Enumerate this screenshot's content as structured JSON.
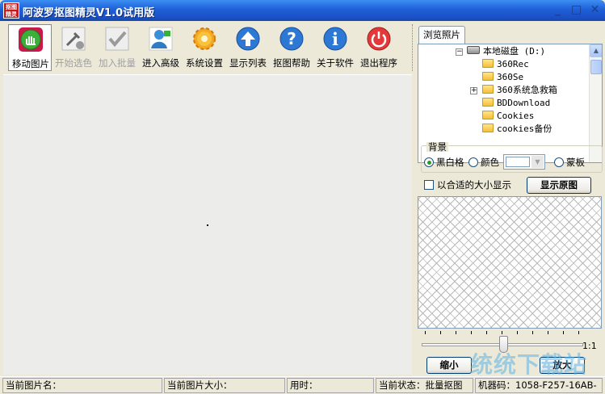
{
  "window": {
    "app_icon_text": "抠图\n精灵",
    "title": "阿波罗抠图精灵V1.0试用版",
    "controls": {
      "minimize": "_",
      "maximize": "□",
      "close": "✕"
    }
  },
  "toolbar": {
    "buttons": [
      {
        "label": "移动图片",
        "icon": "hand-icon",
        "enabled": true,
        "active": true
      },
      {
        "label": "开始选色",
        "icon": "eyedropper-icon",
        "enabled": false
      },
      {
        "label": "加入批量",
        "icon": "checkmark-icon",
        "enabled": false
      },
      {
        "label": "进入高级",
        "icon": "user-icon",
        "enabled": true
      },
      {
        "label": "系统设置",
        "icon": "gear-icon",
        "enabled": true
      },
      {
        "label": "显示列表",
        "icon": "up-arrow-icon",
        "enabled": true
      },
      {
        "label": "抠图帮助",
        "icon": "help-icon",
        "enabled": true
      },
      {
        "label": "关于软件",
        "icon": "info-icon",
        "enabled": true
      },
      {
        "label": "退出程序",
        "icon": "power-icon",
        "enabled": true
      }
    ]
  },
  "browser_panel": {
    "tab_label": "浏览照片",
    "tree": [
      {
        "label": "本地磁盘 (D:)",
        "type": "drive",
        "expanded": true
      },
      {
        "label": "360Rec",
        "type": "folder"
      },
      {
        "label": "360Se",
        "type": "folder"
      },
      {
        "label": "360系统急救箱",
        "type": "folder",
        "expandable": true
      },
      {
        "label": "BDDownload",
        "type": "folder"
      },
      {
        "label": "Cookies",
        "type": "folder"
      },
      {
        "label": "cookies备份",
        "type": "folder"
      }
    ],
    "tree_expand_minus": "−",
    "tree_expand_plus": "+"
  },
  "background_group": {
    "legend": "背景",
    "options": [
      "黑白格",
      "颜色",
      "蒙板"
    ],
    "selected": "黑白格",
    "color_value": "#ffffff"
  },
  "fit_checkbox_label": "以合适的大小显示",
  "fit_checkbox_checked": false,
  "show_original_label": "显示原图",
  "zoom": {
    "ratio": "1:1",
    "level": 0.5,
    "zoom_out_label": "缩小",
    "zoom_in_label": "放大"
  },
  "statusbar": {
    "image_name": "当前图片名：",
    "image_size": "当前图片大小：",
    "time_used": "用时：",
    "status": "当前状态：批量抠图",
    "machine_code": "机器码：1058-F257-16AB-"
  },
  "watermark": "统统下载站"
}
